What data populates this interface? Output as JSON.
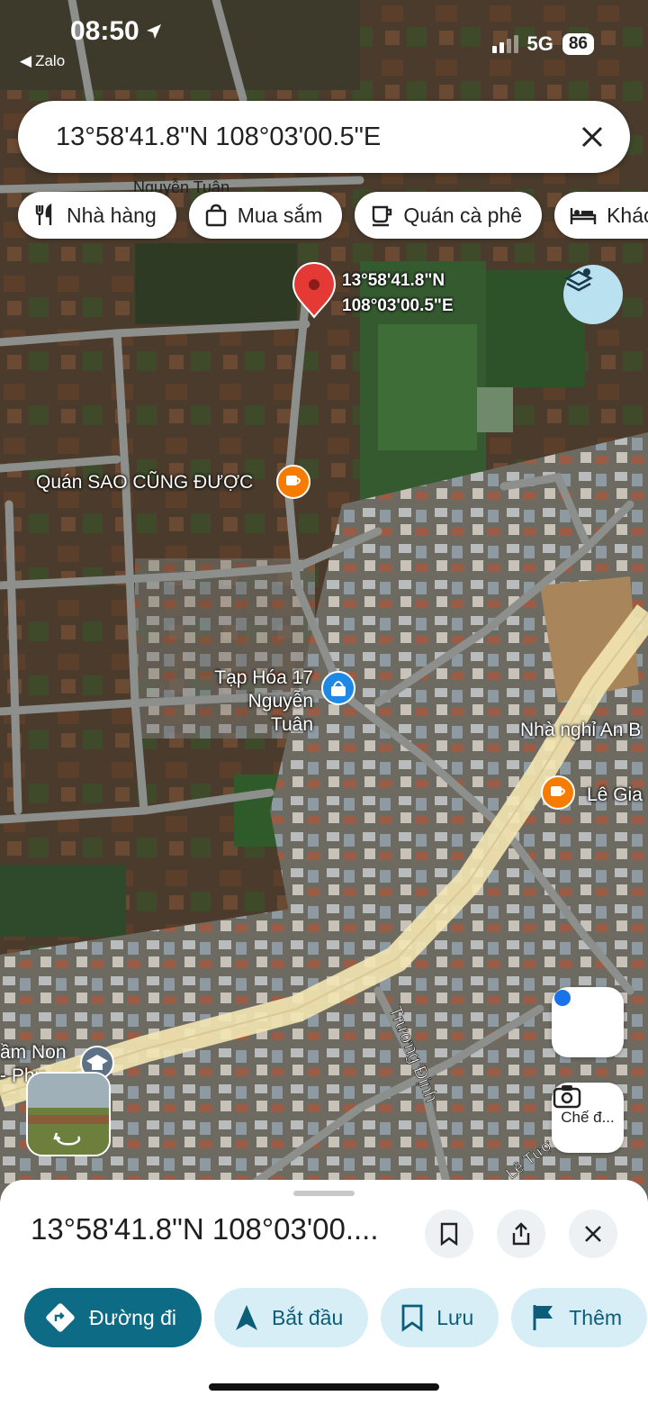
{
  "status_bar": {
    "time": "08:50",
    "back_app": "Zalo",
    "network": "5G",
    "battery": "86"
  },
  "search": {
    "query": "13°58'41.8\"N 108°03'00.5\"E"
  },
  "chips": [
    {
      "label": "Nhà hàng",
      "icon": "fork-knife-icon"
    },
    {
      "label": "Mua sắm",
      "icon": "shopping-bag-icon"
    },
    {
      "label": "Quán cà phê",
      "icon": "coffee-cup-icon"
    },
    {
      "label": "Khác",
      "icon": "bed-icon"
    }
  ],
  "map": {
    "pin": {
      "lat": "13°58'41.8\"N",
      "lng": "108°03'00.5\"E"
    },
    "pois": {
      "cafe1": "Quán SAO CŨNG ĐƯỢC",
      "shop1_line1": "Tạp Hóa 17",
      "shop1_line2": "Nguyễn Tuân",
      "hotel": "Nhà nghỉ An B",
      "cafe2": "Lê Gia",
      "school_line1": "ầm Non",
      "school_line2": "- Phụ"
    },
    "streets": {
      "top": "Nguyễn Tuân",
      "road": "Trương Định",
      "bottom": "Lê Tượ"
    },
    "mode_button_label": "Chế đ..."
  },
  "sheet": {
    "title": "13°58'41.8\"N 108°03'00....",
    "actions": [
      {
        "label": "Đường đi",
        "icon": "directions-icon"
      },
      {
        "label": "Bắt đầu",
        "icon": "navigation-arrow-icon"
      },
      {
        "label": "Lưu",
        "icon": "bookmark-icon"
      },
      {
        "label": "Thêm",
        "icon": "flag-icon"
      }
    ]
  },
  "colors": {
    "accent": "#0d6b86",
    "pin": "#e53935",
    "poi_orange": "#f57c00",
    "poi_blue": "#1e88e5",
    "chip_light": "#d7eef7"
  }
}
